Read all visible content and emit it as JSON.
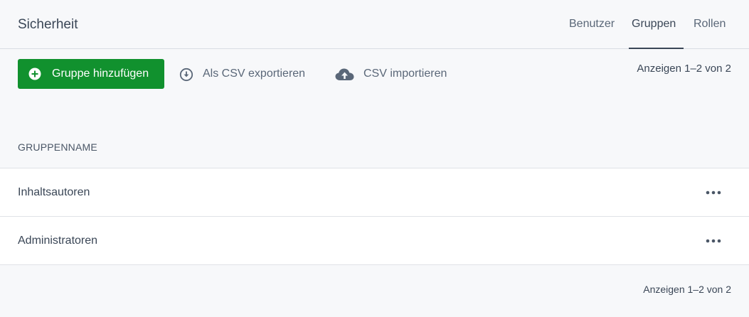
{
  "header": {
    "title": "Sicherheit",
    "tabs": [
      {
        "label": "Benutzer",
        "active": false
      },
      {
        "label": "Gruppen",
        "active": true
      },
      {
        "label": "Rollen",
        "active": false
      }
    ]
  },
  "toolbar": {
    "add_group_label": "Gruppe hinzufügen",
    "export_csv_label": "Als CSV exportieren",
    "import_csv_label": "CSV importieren",
    "pager_text": "Anzeigen 1–2 von 2"
  },
  "table": {
    "column_header": "GRUPPENNAME",
    "rows": [
      {
        "name": "Inhaltsautoren"
      },
      {
        "name": "Administratoren"
      }
    ]
  },
  "footer": {
    "pager_text": "Anzeigen 1–2 von 2"
  },
  "icons": {
    "add": "plus-circle-icon",
    "export": "download-circle-icon",
    "import": "cloud-upload-icon",
    "row_menu": "more-horizontal-icon"
  },
  "colors": {
    "primary_button": "#11912e",
    "background": "#f7f8fa",
    "text": "#3a4656"
  }
}
